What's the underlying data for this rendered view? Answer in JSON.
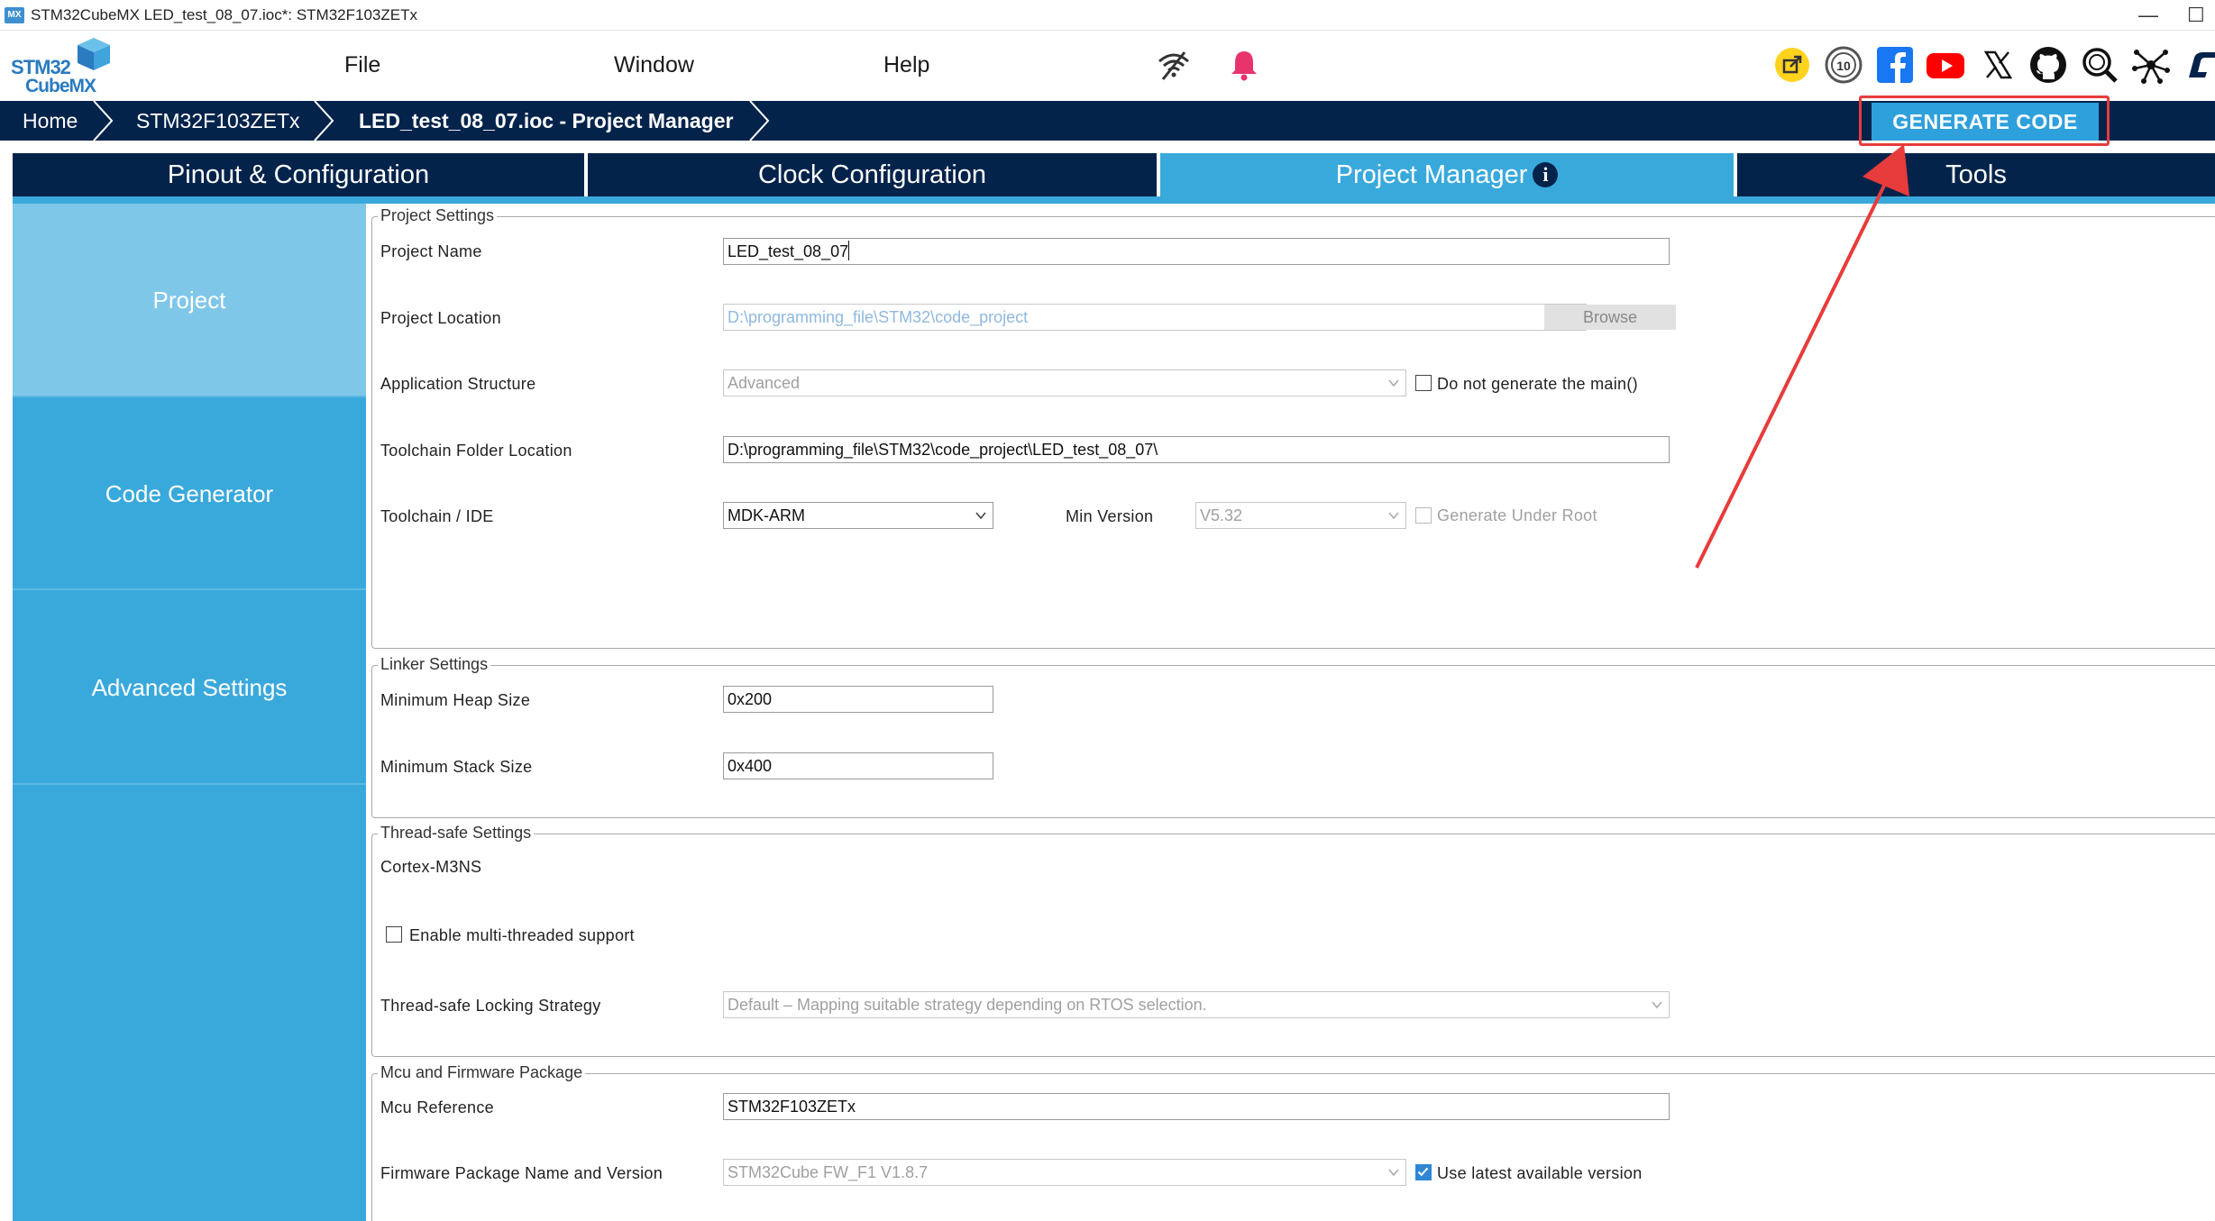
{
  "window": {
    "badge": "MX",
    "title": "STM32CubeMX LED_test_08_07.ioc*: STM32F103ZETx",
    "controls": {
      "minimize": "—",
      "restore": "☐"
    }
  },
  "logo": {
    "line1": "STM32",
    "line2": "CubeMX"
  },
  "menu": {
    "file": "File",
    "window": "Window",
    "help": "Help"
  },
  "toolbar_icons": [
    "wifi-off-icon",
    "bell-icon",
    "share-icon",
    "anniversary-10-icon",
    "facebook-icon",
    "youtube-icon",
    "x-icon",
    "github-icon",
    "community-search-icon",
    "network-icon",
    "st-logo-icon"
  ],
  "breadcrumb": {
    "home": "Home",
    "mcu": "STM32F103ZETx",
    "project": "LED_test_08_07.ioc - Project Manager"
  },
  "generate_button": "GENERATE CODE",
  "tabs": {
    "pinout": "Pinout & Configuration",
    "clock": "Clock Configuration",
    "project_manager": "Project Manager",
    "info_glyph": "i",
    "tools": "Tools"
  },
  "sidebar": {
    "project": "Project",
    "code_generator": "Code Generator",
    "advanced": "Advanced Settings"
  },
  "project_settings": {
    "legend": "Project Settings",
    "project_name_label": "Project Name",
    "project_name_value": "LED_test_08_07",
    "project_location_label": "Project Location",
    "project_location_value": "D:\\programming_file\\STM32\\code_project",
    "browse": "Browse",
    "app_structure_label": "Application Structure",
    "app_structure_value": "Advanced",
    "no_main_label": "Do not generate the main()",
    "toolchain_folder_label": "Toolchain Folder Location",
    "toolchain_folder_value": "D:\\programming_file\\STM32\\code_project\\LED_test_08_07\\",
    "toolchain_label": "Toolchain / IDE",
    "toolchain_value": "MDK-ARM",
    "min_version_label": "Min Version",
    "min_version_value": "V5.32",
    "under_root_label": "Generate Under Root"
  },
  "linker_settings": {
    "legend": "Linker Settings",
    "heap_label": "Minimum Heap Size",
    "heap_value": "0x200",
    "stack_label": "Minimum Stack Size",
    "stack_value": "0x400"
  },
  "thread_safe": {
    "legend": "Thread-safe Settings",
    "core": "Cortex-M3NS",
    "multithread_label": "Enable multi-threaded support",
    "strategy_label": "Thread-safe Locking Strategy",
    "strategy_value": "Default – Mapping suitable strategy depending on RTOS selection."
  },
  "mcu_fw": {
    "legend": "Mcu and Firmware Package",
    "mcu_ref_label": "Mcu Reference",
    "mcu_ref_value": "STM32F103ZETx",
    "fw_label": "Firmware Package Name and Version",
    "fw_value": "STM32Cube FW_F1 V1.8.7",
    "latest_label": "Use latest available version"
  },
  "colors": {
    "navy": "#03234b",
    "accent": "#39a9dc",
    "generate": "#2ea0dc",
    "highlight": "#e83b3b"
  }
}
